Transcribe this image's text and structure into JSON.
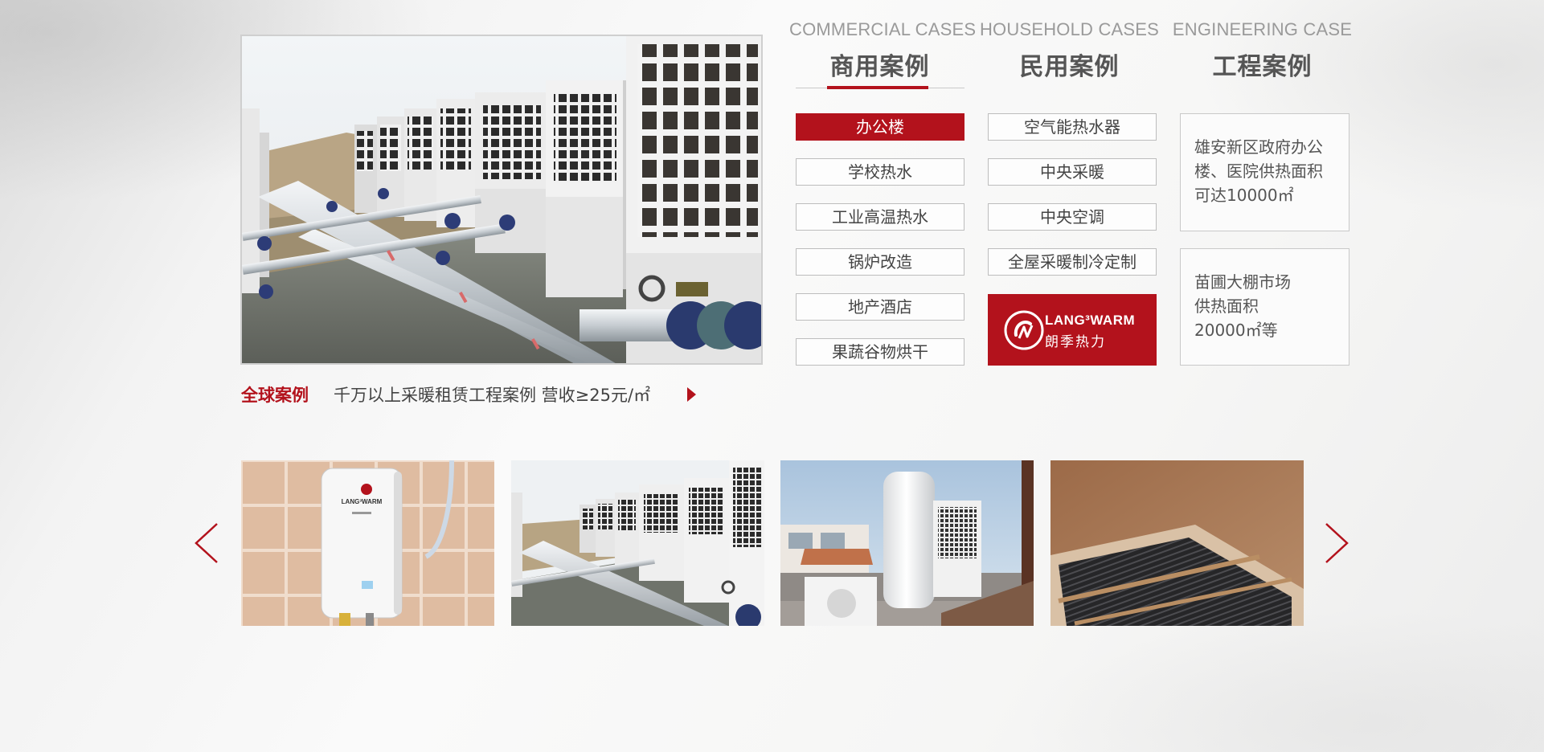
{
  "tabs": [
    {
      "en": "COMMERCIAL CASES",
      "cn": "商用案例"
    },
    {
      "en": "HOUSEHOLD CASES",
      "cn": "民用案例"
    },
    {
      "en": "ENGINEERING CASE",
      "cn": "工程案例"
    }
  ],
  "commercial_options": [
    "办公楼",
    "学校热水",
    "工业高温热水",
    "锅炉改造",
    "地产酒店",
    "果蔬谷物烘干"
  ],
  "household_options": [
    "空气能热水器",
    "中央采暖",
    "中央空调",
    "全屋采暖制冷定制"
  ],
  "logo": {
    "en": "LANG³WARM",
    "cn": "朗季热力"
  },
  "engineering": [
    {
      "lines": [
        "雄安新区政府办公",
        "楼、医院供热面积",
        "可达10000㎡"
      ]
    },
    {
      "lines": [
        "苗圃大棚市场",
        "供热面积",
        "20000㎡等"
      ]
    }
  ],
  "global": {
    "label": "全球案例",
    "text": "千万以上采暖租赁工程案例  营收≥25元/㎡"
  },
  "thumb_water_heater_brand": "LANG³WARM",
  "colors": {
    "accent": "#b3121c",
    "text": "#444444",
    "muted": "#9a9a9a"
  },
  "icons": [
    "play-arrow-icon",
    "chevron-left-icon",
    "chevron-right-icon"
  ]
}
